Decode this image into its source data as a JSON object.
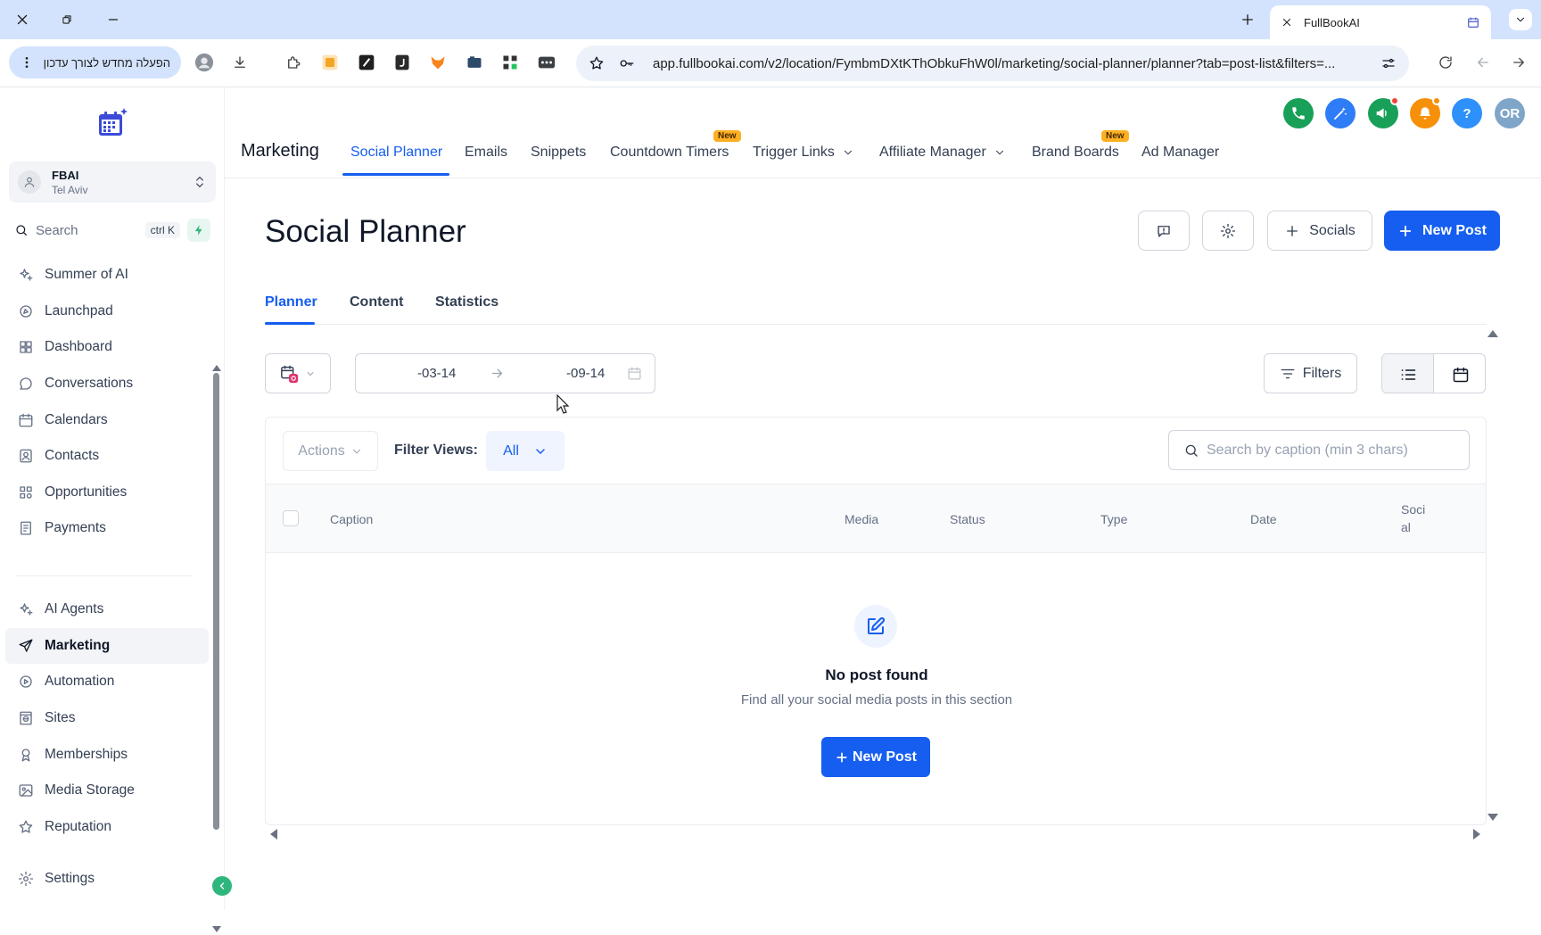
{
  "browser": {
    "tab_title": "FullBookAI",
    "extension_button": "הפעלה מחדש לצורך עדכון",
    "url": "app.fullbookai.com/v2/location/FymbmDXtKThObkuFhW0l/marketing/social-planner/planner?tab=post-list&filters=..."
  },
  "sidebar": {
    "location_name": "FBAI",
    "location_sub": "Tel Aviv",
    "search_label": "Search",
    "search_shortcut": "ctrl K",
    "items": [
      {
        "label": "Summer of AI",
        "icon": "sparkle-icon"
      },
      {
        "label": "Launchpad",
        "icon": "launchpad-icon"
      },
      {
        "label": "Dashboard",
        "icon": "dashboard-icon"
      },
      {
        "label": "Conversations",
        "icon": "chat-icon"
      },
      {
        "label": "Calendars",
        "icon": "calendar-icon"
      },
      {
        "label": "Contacts",
        "icon": "contacts-icon"
      },
      {
        "label": "Opportunities",
        "icon": "opportunities-icon"
      },
      {
        "label": "Payments",
        "icon": "payments-icon"
      }
    ],
    "items2": [
      {
        "label": "AI Agents",
        "icon": "sparkle-icon"
      },
      {
        "label": "Marketing",
        "icon": "send-icon",
        "active": true
      },
      {
        "label": "Automation",
        "icon": "automation-icon"
      },
      {
        "label": "Sites",
        "icon": "sites-icon"
      },
      {
        "label": "Memberships",
        "icon": "membership-icon"
      },
      {
        "label": "Media Storage",
        "icon": "image-icon"
      },
      {
        "label": "Reputation",
        "icon": "star-icon"
      }
    ],
    "settings_label": "Settings"
  },
  "topnav": {
    "module": "Marketing",
    "items": [
      "Social Planner",
      "Emails",
      "Snippets",
      "Countdown Timers",
      "Trigger Links",
      "Affiliate Manager",
      "Brand Boards",
      "Ad Manager"
    ],
    "new_badge": "New",
    "avatar_initials": "OR",
    "help_label": "?"
  },
  "page": {
    "title": "Social Planner",
    "socials_label": "Socials",
    "new_post_label": "New Post",
    "subtabs": [
      "Planner",
      "Content",
      "Statistics"
    ]
  },
  "filters": {
    "date_from": "-03-14",
    "date_to": "-09-14",
    "filters_label": "Filters"
  },
  "table": {
    "actions_label": "Actions",
    "filter_views_label": "Filter Views:",
    "filter_views_value": "All",
    "search_placeholder": "Search by caption (min 3 chars)",
    "columns": [
      "Caption",
      "Media",
      "Status",
      "Type",
      "Date",
      "Soci",
      "al"
    ],
    "empty_title": "No post found",
    "empty_subtitle": "Find all your social media posts in this section",
    "empty_button": "New Post"
  },
  "colors": {
    "primary": "#155eef",
    "call": "#18a058",
    "notify": "#f79009",
    "avatar": "#7fa6c9"
  }
}
